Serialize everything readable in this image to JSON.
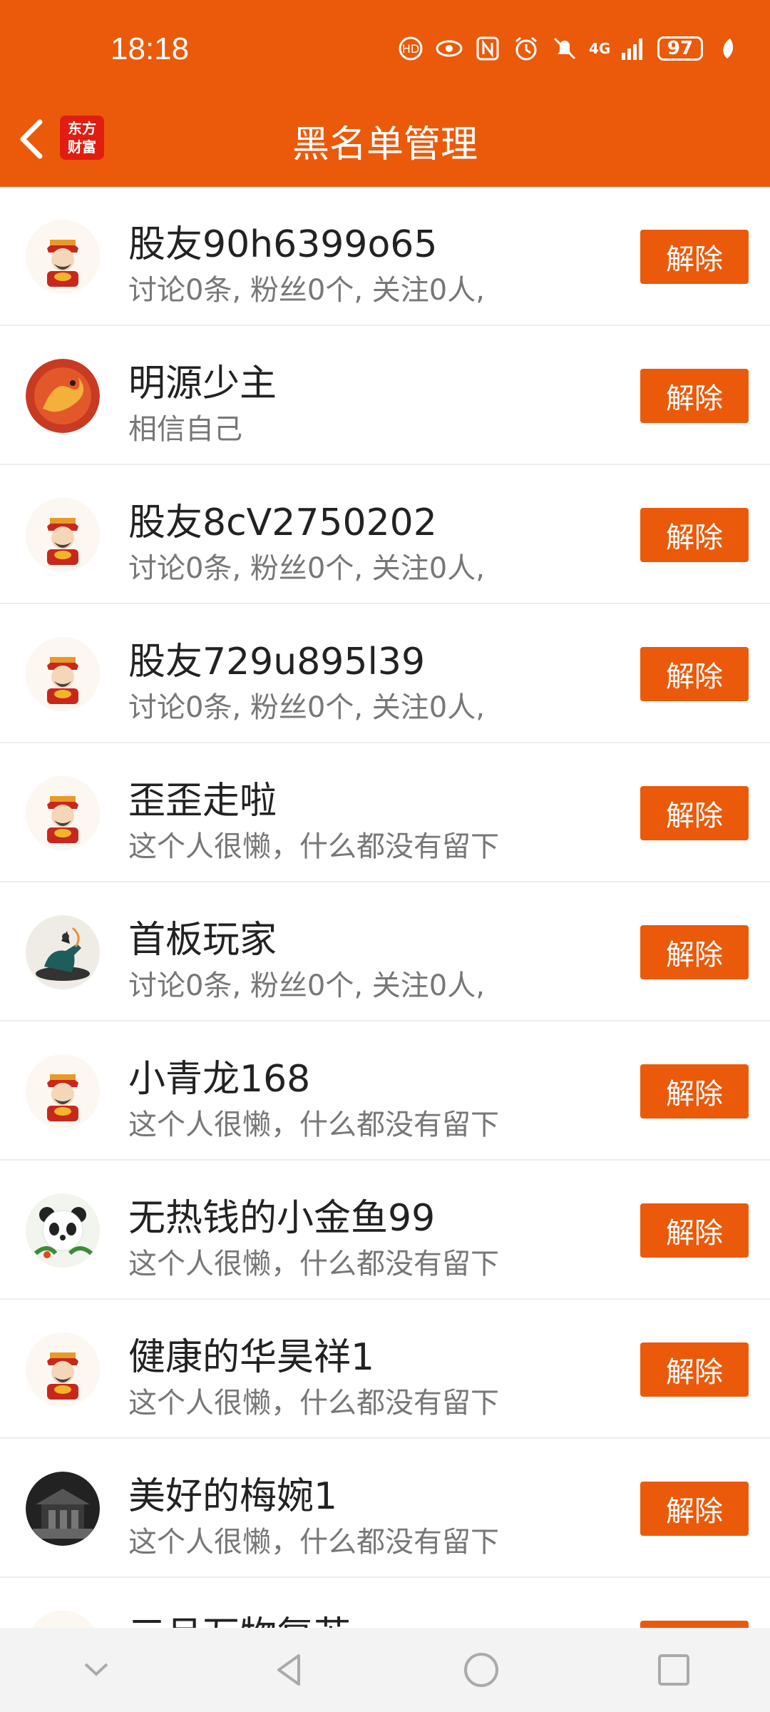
{
  "status_bar": {
    "time": "18:18",
    "network": "4G",
    "battery": "97"
  },
  "header": {
    "title": "黑名单管理",
    "logo_line1": "东方",
    "logo_line2": "财富"
  },
  "unblock_label": "解除",
  "rows": [
    {
      "name": "股友90h6399o65",
      "desc": "讨论0条, 粉丝0个, 关注0人,",
      "avatar": "caishen-avatar"
    },
    {
      "name": "明源少主",
      "desc": "相信自己",
      "avatar": "dragon-avatar"
    },
    {
      "name": "股友8cV2750202",
      "desc": "讨论0条, 粉丝0个, 关注0人,",
      "avatar": "caishen-avatar"
    },
    {
      "name": "股友729u895l39",
      "desc": "讨论0条, 粉丝0个, 关注0人,",
      "avatar": "caishen-avatar"
    },
    {
      "name": "歪歪走啦",
      "desc": "这个人很懒，什么都没有留下",
      "avatar": "caishen-avatar"
    },
    {
      "name": "首板玩家",
      "desc": "讨论0条, 粉丝0个, 关注0人,",
      "avatar": "horse-rider-avatar"
    },
    {
      "name": "小青龙168",
      "desc": "这个人很懒，什么都没有留下",
      "avatar": "caishen-avatar"
    },
    {
      "name": "无热钱的小金鱼99",
      "desc": "这个人很懒，什么都没有留下",
      "avatar": "panda-avatar"
    },
    {
      "name": "健康的华昊祥1",
      "desc": "这个人很懒，什么都没有留下",
      "avatar": "caishen-avatar"
    },
    {
      "name": "美好的梅婉1",
      "desc": "这个人很懒，什么都没有留下",
      "avatar": "building-avatar"
    },
    {
      "name": "三月万物复苏",
      "desc": "",
      "avatar": "caishen-avatar"
    }
  ],
  "colors": {
    "accent": "#EA5A0A",
    "logo_red": "#E01D10"
  }
}
